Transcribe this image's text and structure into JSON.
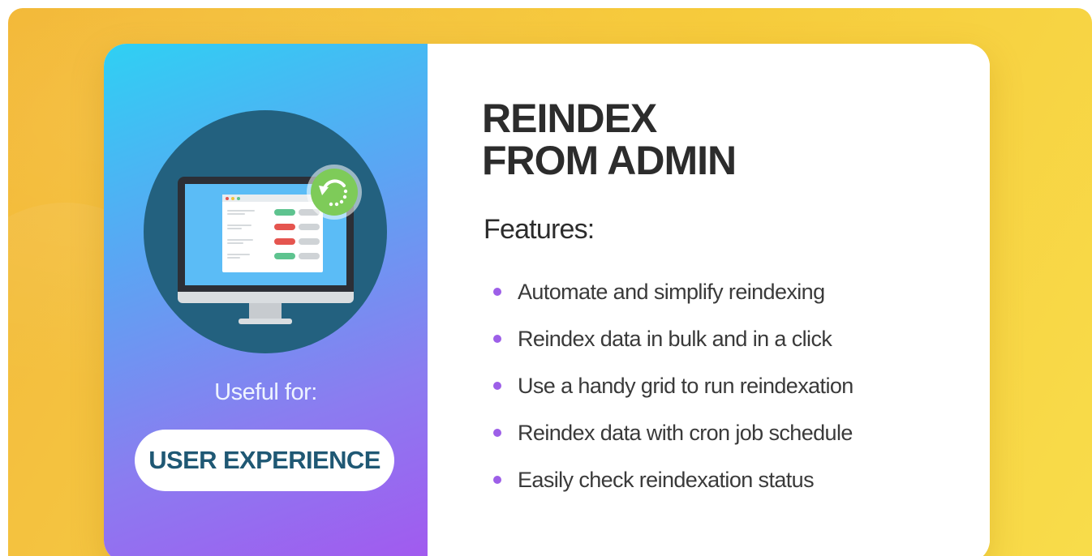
{
  "colors": {
    "background_yellow": "#f6c93a",
    "gradient_start": "#2fd0f3",
    "gradient_end": "#a259ef",
    "circle": "#23617f",
    "title": "#2c2c2c",
    "bullet": "#9d5fe8",
    "pill_text": "#1f5874",
    "refresh_badge": "#7ecb59",
    "pill_green": "#5ec38f",
    "pill_red": "#e5554f"
  },
  "left_panel": {
    "illustration_icon": "monitor-icon",
    "badge_icon": "refresh-icon",
    "useful_for_label": "Useful for:",
    "useful_for_value": "USER EXPERIENCE"
  },
  "right_panel": {
    "title_line1": "REINDEX",
    "title_line2": "FROM ADMIN",
    "features_heading": "Features:",
    "features": [
      "Automate and simplify reindexing",
      "Reindex data in bulk and in a click",
      "Use a handy grid to run reindexation",
      "Reindex data with cron job schedule",
      "Easily check reindexation status"
    ]
  }
}
